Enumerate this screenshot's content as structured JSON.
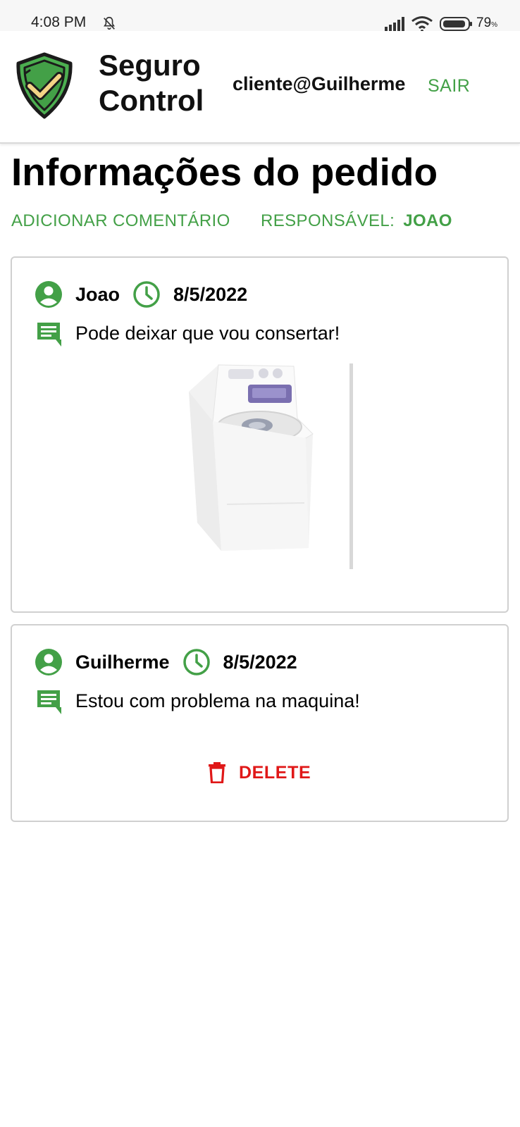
{
  "status_bar": {
    "time": "4:08 PM",
    "battery_percent": "79",
    "battery_unit": "%"
  },
  "header": {
    "app_title_line1": "Seguro",
    "app_title_line2": "Control",
    "user_email": "cliente@Guilherme",
    "logout_label": "SAIR"
  },
  "page": {
    "title": "Informações do pedido",
    "add_comment_label": "ADICIONAR COMENTÁRIO",
    "responsible_label": "RESPONSÁVEL:",
    "responsible_name": "JOAO"
  },
  "comments": [
    {
      "author": "Joao",
      "date": "8/5/2022",
      "text": "Pode deixar que vou consertar!",
      "has_image": true
    },
    {
      "author": "Guilherme",
      "date": "8/5/2022",
      "text": "Estou com problema na maquina!",
      "delete_label": "DELETE"
    }
  ],
  "colors": {
    "accent": "#43a047",
    "danger": "#e01818",
    "shield_fill": "#4caf50",
    "check_color": "#f3d486"
  },
  "icons": [
    "bell-off-icon",
    "signal-icon",
    "wifi-icon",
    "battery-icon",
    "shield-check-icon",
    "account-circle-icon",
    "clock-icon",
    "comment-icon",
    "trash-icon"
  ]
}
